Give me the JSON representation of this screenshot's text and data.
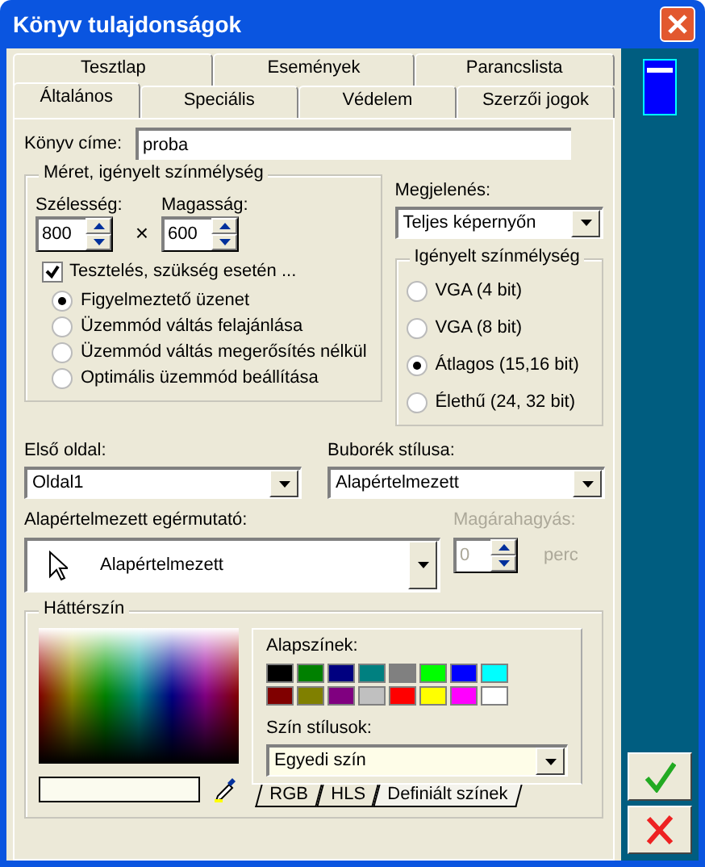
{
  "window": {
    "title": "Könyv tulajdonságok"
  },
  "tab_rows": [
    [
      {
        "label": "Tesztlap",
        "selected": false
      },
      {
        "label": "Események",
        "selected": false
      },
      {
        "label": "Parancslista",
        "selected": false
      }
    ],
    [
      {
        "label": "Általános",
        "selected": true
      },
      {
        "label": "Speciális",
        "selected": false
      },
      {
        "label": "Védelem",
        "selected": false
      },
      {
        "label": "Szerzői jogok",
        "selected": false
      }
    ]
  ],
  "book_title": {
    "label": "Könyv címe:",
    "value": "proba"
  },
  "size_group": {
    "title": "Méret, igényelt színmélység",
    "width": {
      "label": "Szélesség:",
      "value": "800"
    },
    "height": {
      "label": "Magasság:",
      "value": "600"
    },
    "times": "×",
    "test": {
      "label": "Tesztelés, szükség esetén ...",
      "checked": true
    },
    "modes": [
      {
        "label": "Figyelmeztető üzenet",
        "selected": true
      },
      {
        "label": "Üzemmód váltás felajánlása",
        "selected": false
      },
      {
        "label": "Üzemmód váltás megerősítés nélkül",
        "selected": false
      },
      {
        "label": "Optimális üzemmód beállítása",
        "selected": false
      }
    ]
  },
  "display": {
    "label": "Megjelenés:",
    "value": "Teljes képernyőn"
  },
  "depth_group": {
    "title": "Igényelt színmélység",
    "options": [
      {
        "label": "VGA (4 bit)",
        "selected": false
      },
      {
        "label": "VGA (8 bit)",
        "selected": false
      },
      {
        "label": "Átlagos (15,16 bit)",
        "selected": true
      },
      {
        "label": "Élethű (24, 32 bit)",
        "selected": false
      }
    ]
  },
  "first_page": {
    "label": "Első oldal:",
    "value": "Oldal1"
  },
  "bubble_style": {
    "label": "Buborék stílusa:",
    "value": "Alapértelmezett"
  },
  "cursor": {
    "label": "Alapértelmezett egérmutató:",
    "value": "Alapértelmezett"
  },
  "idle": {
    "label": "Magárahagyás:",
    "value": "0",
    "unit": "perc",
    "disabled": true
  },
  "background": {
    "title": "Háttérszín",
    "basic_label": "Alapszínek:",
    "swatches": [
      {
        "color": "#000000"
      },
      {
        "color": "#008000"
      },
      {
        "color": "#000080"
      },
      {
        "color": "#008080"
      },
      {
        "color": "#808080"
      },
      {
        "color": "#00ff00"
      },
      {
        "color": "#0000ff"
      },
      {
        "color": "#00ffff"
      },
      {
        "color": "#800000"
      },
      {
        "color": "#808000"
      },
      {
        "color": "#800080"
      },
      {
        "color": "#c0c0c0"
      },
      {
        "color": "#ff0000"
      },
      {
        "color": "#ffff00"
      },
      {
        "color": "#ff00ff"
      },
      {
        "color": "#ffffff"
      }
    ],
    "style": {
      "label": "Szín stílusok:",
      "value": "Egyedi szín"
    },
    "color_tabs": [
      {
        "label": "RGB",
        "selected": false
      },
      {
        "label": "HLS",
        "selected": false
      },
      {
        "label": "Definiált színek",
        "selected": true
      }
    ]
  },
  "buttons": [
    {
      "kind": "ok"
    },
    {
      "kind": "cancel"
    }
  ]
}
